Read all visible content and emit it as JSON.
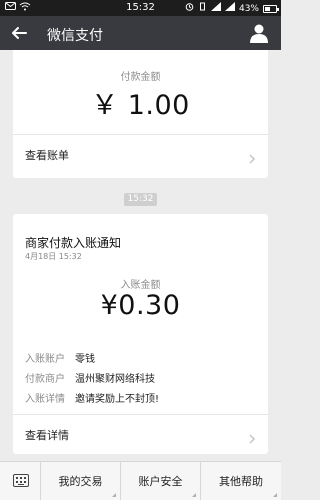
{
  "status_bar": {
    "time": "15:32",
    "battery": "43%",
    "battery_level": 0.43
  },
  "nav": {
    "title": "微信支付"
  },
  "payment_card": {
    "amount_label": "付款金额",
    "amount": "￥ 1.00",
    "link_label": "查看账单"
  },
  "time_badge": "15:32",
  "notice_card": {
    "title": "商家付款入账通知",
    "date": "4月18日  15:32",
    "amount_label": "入账金额",
    "amount": "¥0.30",
    "details": [
      {
        "key": "入账账户",
        "value": "零钱"
      },
      {
        "key": "付款商户",
        "value": "温州聚财网络科技"
      },
      {
        "key": "入账详情",
        "value": "邀请奖励上不封顶!"
      }
    ],
    "link_label": "查看详情"
  },
  "bottom_menu": {
    "items": [
      "我的交易",
      "账户安全",
      "其他帮助"
    ]
  }
}
